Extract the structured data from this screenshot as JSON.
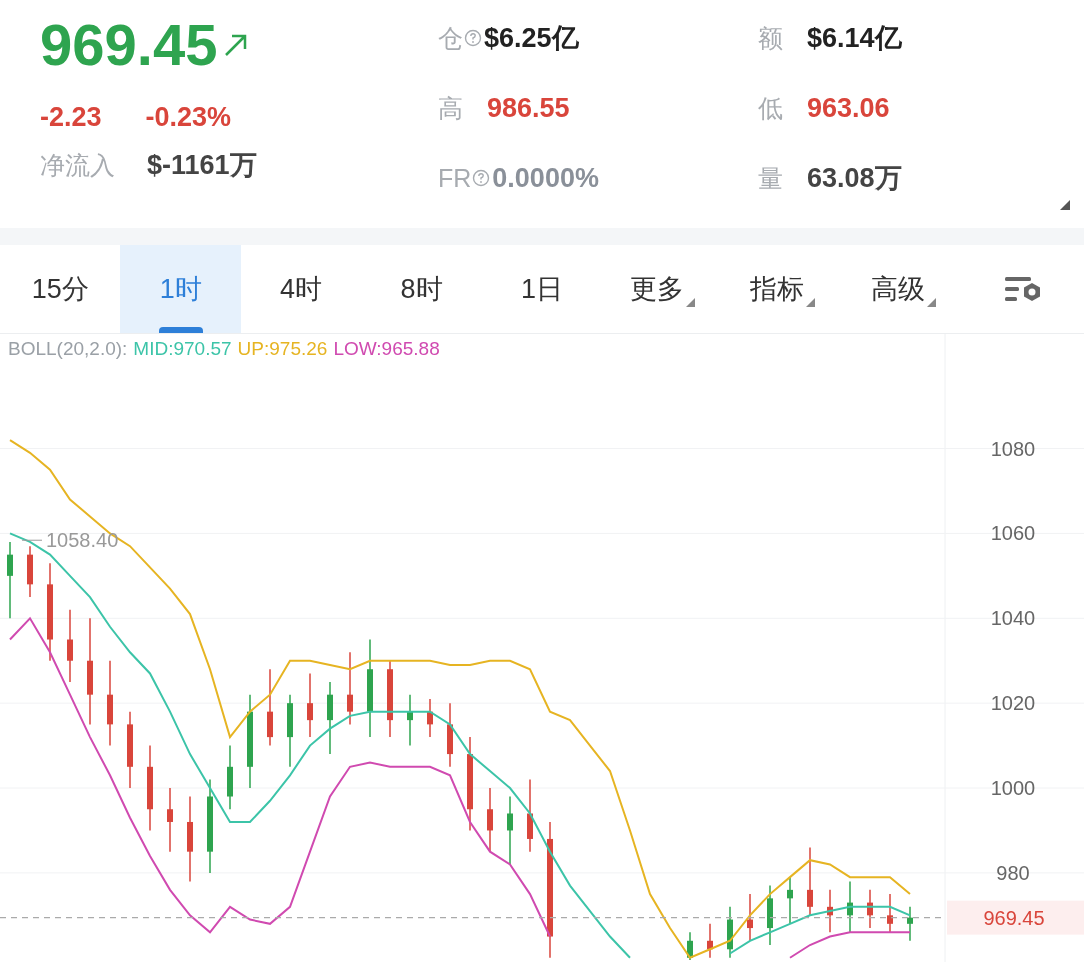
{
  "quote": {
    "price": "969.45",
    "rising": true,
    "change": "-2.23",
    "change_pct": "-0.23%",
    "netflow_label": "净流入",
    "netflow_value": "$-1161万"
  },
  "stats": [
    {
      "label": "仓",
      "help": true,
      "value": "$6.25亿",
      "color": "#222222"
    },
    {
      "label": "额",
      "help": false,
      "value": "$6.14亿",
      "color": "#222222"
    },
    {
      "label": "高",
      "help": false,
      "value": "986.55",
      "color": "#d9453b"
    },
    {
      "label": "低",
      "help": false,
      "value": "963.06",
      "color": "#d9453b"
    },
    {
      "label": "FR",
      "help": true,
      "value": "0.0000%",
      "color": "#8a9099"
    },
    {
      "label": "量",
      "help": false,
      "value": "63.08万",
      "color": "#444444"
    }
  ],
  "tabs": [
    {
      "label": "15分",
      "kind": "plain",
      "selected": false
    },
    {
      "label": "1时",
      "kind": "plain",
      "selected": true
    },
    {
      "label": "4时",
      "kind": "plain",
      "selected": false
    },
    {
      "label": "8时",
      "kind": "plain",
      "selected": false
    },
    {
      "label": "1日",
      "kind": "plain",
      "selected": false
    },
    {
      "label": "更多",
      "kind": "dropdown",
      "selected": false
    },
    {
      "label": "指标",
      "kind": "dropdown",
      "selected": false
    },
    {
      "label": "高级",
      "kind": "dropdown",
      "selected": false
    },
    {
      "kind": "settings",
      "selected": false
    }
  ],
  "chart": {
    "indicator_label": "BOLL(20,2.0):",
    "legend_readings": [
      ":970.57",
      ":975.26",
      ":965.88"
    ],
    "chart_data": {
      "type": "candlestick",
      "grid": true,
      "ylim": [
        959,
        1107
      ],
      "yticks": [
        1080,
        1060,
        1040,
        1020,
        1000,
        980
      ],
      "ref_lines": [
        {
          "axis": "y",
          "value": 969.45,
          "label": "969.45"
        }
      ],
      "annotations": [
        "1058.40"
      ],
      "ohlc": [
        [
          1050,
          1058,
          1040,
          1055
        ],
        [
          1055,
          1057,
          1045,
          1048
        ],
        [
          1048,
          1053,
          1030,
          1035
        ],
        [
          1035,
          1042,
          1025,
          1030
        ],
        [
          1030,
          1040,
          1015,
          1022
        ],
        [
          1022,
          1030,
          1010,
          1015
        ],
        [
          1015,
          1018,
          1000,
          1005
        ],
        [
          1005,
          1010,
          990,
          995
        ],
        [
          995,
          1000,
          985,
          992
        ],
        [
          992,
          998,
          978,
          985
        ],
        [
          985,
          1002,
          980,
          998
        ],
        [
          998,
          1010,
          995,
          1005
        ],
        [
          1005,
          1022,
          1000,
          1018
        ],
        [
          1018,
          1028,
          1010,
          1012
        ],
        [
          1012,
          1022,
          1005,
          1020
        ],
        [
          1020,
          1027,
          1012,
          1016
        ],
        [
          1016,
          1025,
          1008,
          1022
        ],
        [
          1022,
          1032,
          1015,
          1018
        ],
        [
          1018,
          1035,
          1012,
          1028
        ],
        [
          1028,
          1030,
          1012,
          1016
        ],
        [
          1016,
          1022,
          1010,
          1018
        ],
        [
          1018,
          1021,
          1012,
          1015
        ],
        [
          1015,
          1020,
          1005,
          1008
        ],
        [
          1008,
          1012,
          990,
          995
        ],
        [
          995,
          1000,
          985,
          990
        ],
        [
          990,
          998,
          982,
          994
        ],
        [
          994,
          1002,
          985,
          988
        ],
        [
          988,
          992,
          960,
          965
        ],
        null,
        null,
        null,
        null,
        null,
        null,
        [
          960,
          966,
          959.5,
          964
        ],
        [
          964,
          968,
          960,
          962
        ],
        [
          962,
          972,
          960,
          969
        ],
        [
          969,
          975,
          964,
          967
        ],
        [
          967,
          977,
          963,
          974
        ],
        [
          974,
          979,
          968,
          976
        ],
        [
          976,
          986,
          970,
          972
        ],
        [
          972,
          976,
          966,
          970
        ],
        [
          970,
          978,
          966,
          973
        ],
        [
          973,
          976,
          967,
          970
        ],
        [
          970,
          975,
          966,
          968
        ],
        [
          968,
          972,
          964,
          969.45
        ]
      ],
      "series": [
        {
          "name": "MID",
          "type": "line",
          "color": "#3cc4a8",
          "values": [
            1060,
            1058,
            1055,
            1050,
            1045,
            1038,
            1032,
            1027,
            1018,
            1008,
            1000,
            992,
            992,
            997,
            1003,
            1010,
            1014,
            1017,
            1018,
            1018,
            1018,
            1018,
            1015,
            1008,
            1004,
            1000,
            994,
            985,
            977,
            971,
            965,
            960,
            null,
            null,
            null,
            null,
            961,
            964,
            966,
            968,
            970,
            971,
            972,
            972,
            972,
            970
          ]
        },
        {
          "name": "UP",
          "type": "line",
          "color": "#e6b422",
          "values": [
            1082,
            1079,
            1075,
            1068,
            1064,
            1060,
            1057,
            1052,
            1047,
            1041,
            1028,
            1012,
            1018,
            1022,
            1030,
            1030,
            1029,
            1028,
            1030,
            1030,
            1030,
            1030,
            1029,
            1029,
            1030,
            1030,
            1028,
            1018,
            1016,
            1010,
            1004,
            990,
            975,
            967,
            960,
            962,
            964,
            970,
            975,
            979,
            983,
            982,
            979,
            979,
            979,
            975
          ]
        },
        {
          "name": "LOW",
          "type": "line",
          "color": "#d04ab0",
          "values": [
            1035,
            1040,
            1032,
            1022,
            1012,
            1003,
            993,
            984,
            976,
            970,
            966,
            972,
            969,
            968,
            972,
            985,
            998,
            1005,
            1006,
            1005,
            1005,
            1005,
            1003,
            992,
            985,
            982,
            975,
            965,
            null,
            null,
            null,
            null,
            null,
            null,
            null,
            null,
            null,
            null,
            null,
            960,
            963,
            965,
            966,
            966,
            966,
            966
          ]
        }
      ]
    }
  }
}
